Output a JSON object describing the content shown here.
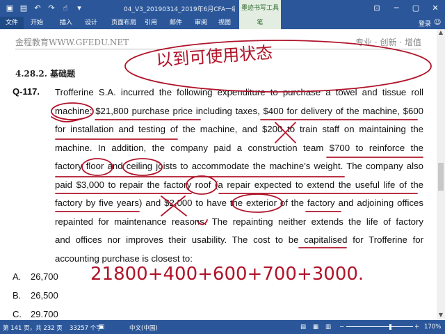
{
  "window": {
    "title": "04_V3_20190314_2019年6月CFA一级百题预...",
    "context_tool": "墨迹书写工具",
    "minimize": "─",
    "maximize": "▢",
    "close": "✕"
  },
  "ribbon": {
    "tabs": [
      "文件",
      "开始",
      "插入",
      "设计",
      "页面布局",
      "引用",
      "邮件",
      "审阅",
      "视图",
      "笔"
    ],
    "login": "登录"
  },
  "document": {
    "header_left": "金程教育WWW.GFEDU.NET",
    "header_right": "专业 · 创新 · 增值",
    "section_title": "4.28.2.  基础题",
    "question_number": "Q-117.",
    "question_lines": [
      "Trofferine S.A. incurred the following expenditure to purchase a towel and tissue roll",
      "machine: $21,800 purchase price including taxes, $400 for delivery of the machine, $600",
      "for installation and testing of the machine, and $200 to train staff on maintaining the",
      "machine. In addition, the company paid a construction team $700 to reinforce the",
      "factory floor and ceiling joists to accommodate the machine’s weight. The company also",
      "paid $3,000 to repair the factory roof (a repair expected to extend the useful life of the",
      "factory by five years) and $2,000 to have the exterior of the factory and adjoining offices",
      "repainted for maintenance reasons. The repainting neither extends the life of factory",
      "and offices nor improves their usability. The cost to be capitalised for Trofferine for",
      "accounting purchase is closest to:"
    ],
    "options": [
      {
        "letter": "A.",
        "value": "26,700"
      },
      {
        "letter": "B.",
        "value": "26,500"
      },
      {
        "letter": "C.",
        "value": "29,700"
      }
    ],
    "handwriting": [
      "以到可使用状态",
      "21800+400+600+700+3000."
    ]
  },
  "statusbar": {
    "page": "第 141 页，共 232 页",
    "words": "33257 个字",
    "language": "中文(中国)",
    "zoom": "170%"
  },
  "colors": {
    "word_blue": "#2b579a",
    "ink_red": "#b0142a",
    "context_green": "#e3ede1"
  }
}
